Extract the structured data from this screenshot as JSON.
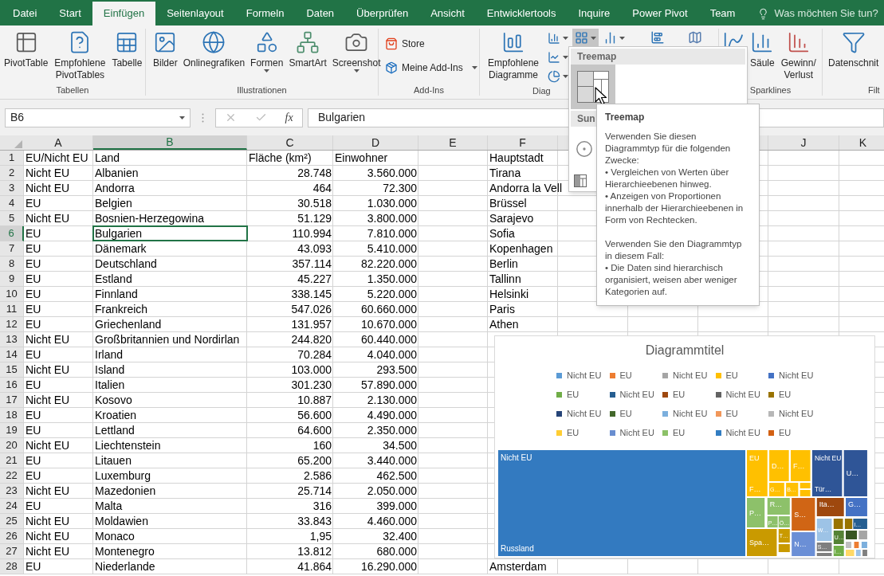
{
  "tabs": [
    {
      "label": "Datei",
      "selected": false
    },
    {
      "label": "Start",
      "selected": false
    },
    {
      "label": "Einfügen",
      "selected": true
    },
    {
      "label": "Seitenlayout",
      "selected": false
    },
    {
      "label": "Formeln",
      "selected": false
    },
    {
      "label": "Daten",
      "selected": false
    },
    {
      "label": "Überprüfen",
      "selected": false
    },
    {
      "label": "Ansicht",
      "selected": false
    },
    {
      "label": "Entwicklertools",
      "selected": false
    },
    {
      "label": "Inquire",
      "selected": false
    },
    {
      "label": "Power Pivot",
      "selected": false
    },
    {
      "label": "Team",
      "selected": false
    }
  ],
  "tell_me": {
    "placeholder": "Was möchten Sie tun?"
  },
  "ribbon": {
    "groups": [
      {
        "label": "Tabellen",
        "buttons": [
          {
            "label": "PivotTable",
            "dropdown": false
          },
          {
            "label": "Empfohlene PivotTables",
            "dropdown": false
          },
          {
            "label": "Tabelle",
            "dropdown": false
          }
        ]
      },
      {
        "label": "Illustrationen",
        "buttons": [
          {
            "label": "Bilder",
            "dropdown": false
          },
          {
            "label": "Onlinegrafiken",
            "dropdown": false
          },
          {
            "label": "Formen",
            "dropdown": true
          },
          {
            "label": "SmartArt",
            "dropdown": false
          },
          {
            "label": "Screenshot",
            "dropdown": true
          }
        ]
      },
      {
        "label": "Add-Ins",
        "buttons": [
          {
            "label": "Store",
            "dropdown": false
          },
          {
            "label": "Meine Add-Ins",
            "dropdown": true
          }
        ]
      },
      {
        "label": "Diag",
        "buttons": [
          {
            "label": "Empfohlene Diagramme",
            "dropdown": false
          }
        ],
        "small_buttons": [
          {
            "pressed": false
          },
          {
            "pressed": false
          },
          {
            "pressed": false
          },
          {
            "pressed": true
          },
          {
            "pressed": false
          }
        ]
      },
      {
        "label": "Sparklines",
        "buttons": [
          {
            "label": "Säule",
            "dropdown": false
          },
          {
            "label": "Gewinn/\nVerlust",
            "dropdown": false
          }
        ]
      },
      {
        "label": "Filt",
        "buttons": [
          {
            "label": "Datenschnit",
            "dropdown": false
          }
        ]
      }
    ]
  },
  "formula_bar": {
    "name_box": "B6",
    "function_button": "fx",
    "value": "Bulgarien"
  },
  "columns": [
    {
      "letter": "A",
      "selected": false
    },
    {
      "letter": "B",
      "selected": true
    },
    {
      "letter": "C",
      "selected": false
    },
    {
      "letter": "D",
      "selected": false
    },
    {
      "letter": "E",
      "selected": false
    },
    {
      "letter": "F",
      "selected": false
    },
    {
      "letter": "J",
      "selected": false
    },
    {
      "letter": "K",
      "selected": false
    }
  ],
  "rows": [
    {
      "number": "1",
      "selected": false,
      "a": "EU/Nicht EU",
      "b": "Land",
      "c": "Fläche (km²)",
      "d": "Einwohner",
      "f": "Hauptstadt"
    },
    {
      "number": "2",
      "selected": false,
      "a": "Nicht EU",
      "b": "Albanien",
      "c": "28.748",
      "d": "3.560.000",
      "f": "Tirana"
    },
    {
      "number": "3",
      "selected": false,
      "a": "Nicht EU",
      "b": "Andorra",
      "c": "464",
      "d": "72.300",
      "f": "Andorra la Vell"
    },
    {
      "number": "4",
      "selected": false,
      "a": "EU",
      "b": "Belgien",
      "c": "30.518",
      "d": "1.030.000",
      "f": "Brüssel"
    },
    {
      "number": "5",
      "selected": false,
      "a": "Nicht EU",
      "b": "Bosnien-Herzegowina",
      "c": "51.129",
      "d": "3.800.000",
      "f": "Sarajevo"
    },
    {
      "number": "6",
      "selected": true,
      "a": "EU",
      "b": "Bulgarien",
      "c": "110.994",
      "d": "7.810.000",
      "f": "Sofia"
    },
    {
      "number": "7",
      "selected": false,
      "a": "EU",
      "b": "Dänemark",
      "c": "43.093",
      "d": "5.410.000",
      "f": "Kopenhagen"
    },
    {
      "number": "8",
      "selected": false,
      "a": "EU",
      "b": "Deutschland",
      "c": "357.114",
      "d": "82.220.000",
      "f": "Berlin"
    },
    {
      "number": "9",
      "selected": false,
      "a": "EU",
      "b": "Estland",
      "c": "45.227",
      "d": "1.350.000",
      "f": "Tallinn"
    },
    {
      "number": "10",
      "selected": false,
      "a": "EU",
      "b": "Finnland",
      "c": "338.145",
      "d": "5.220.000",
      "f": "Helsinki"
    },
    {
      "number": "11",
      "selected": false,
      "a": "EU",
      "b": "Frankreich",
      "c": "547.026",
      "d": "60.660.000",
      "f": "Paris"
    },
    {
      "number": "12",
      "selected": false,
      "a": "EU",
      "b": "Griechenland",
      "c": "131.957",
      "d": "10.670.000",
      "f": "Athen"
    },
    {
      "number": "13",
      "selected": false,
      "a": "Nicht EU",
      "b": "Großbritannien und Nordirlan",
      "c": "244.820",
      "d": "60.440.000"
    },
    {
      "number": "14",
      "selected": false,
      "a": "EU",
      "b": "Irland",
      "c": "70.284",
      "d": "4.040.000"
    },
    {
      "number": "15",
      "selected": false,
      "a": "Nicht EU",
      "b": "Island",
      "c": "103.000",
      "d": "293.500"
    },
    {
      "number": "16",
      "selected": false,
      "a": "EU",
      "b": "Italien",
      "c": "301.230",
      "d": "57.890.000"
    },
    {
      "number": "17",
      "selected": false,
      "a": "Nicht EU",
      "b": "Kosovo",
      "c": "10.887",
      "d": "2.130.000"
    },
    {
      "number": "18",
      "selected": false,
      "a": "EU",
      "b": "Kroatien",
      "c": "56.600",
      "d": "4.490.000"
    },
    {
      "number": "19",
      "selected": false,
      "a": "EU",
      "b": "Lettland",
      "c": "64.600",
      "d": "2.350.000"
    },
    {
      "number": "20",
      "selected": false,
      "a": "Nicht EU",
      "b": "Liechtenstein",
      "c": "160",
      "d": "34.500"
    },
    {
      "number": "21",
      "selected": false,
      "a": "EU",
      "b": "Litauen",
      "c": "65.200",
      "d": "3.440.000"
    },
    {
      "number": "22",
      "selected": false,
      "a": "EU",
      "b": "Luxemburg",
      "c": "2.586",
      "d": "462.500"
    },
    {
      "number": "23",
      "selected": false,
      "a": "Nicht EU",
      "b": "Mazedonien",
      "c": "25.714",
      "d": "2.050.000"
    },
    {
      "number": "24",
      "selected": false,
      "a": "EU",
      "b": "Malta",
      "c": "316",
      "d": "399.000"
    },
    {
      "number": "25",
      "selected": false,
      "a": "Nicht EU",
      "b": "Moldawien",
      "c": "33.843",
      "d": "4.460.000"
    },
    {
      "number": "26",
      "selected": false,
      "a": "Nicht EU",
      "b": "Monaco",
      "c": "1,95",
      "d": "32.400"
    },
    {
      "number": "27",
      "selected": false,
      "a": "Nicht EU",
      "b": "Montenegro",
      "c": "13.812",
      "d": "680.000"
    },
    {
      "number": "28",
      "selected": false,
      "a": "EU",
      "b": "Niederlande",
      "c": "41.864",
      "d": "16.290.000",
      "f": "Amsterdam"
    }
  ],
  "chart_menu": {
    "sections": [
      {
        "title": "Treemap",
        "selected": true
      },
      {
        "title": "Sun",
        "selected": false
      }
    ]
  },
  "tooltip": {
    "title": "Treemap",
    "sections": [
      {
        "lines": [
          "Verwenden Sie diesen Diagrammtyp für die folgenden Zwecke:",
          "• Vergleichen von Werten über Hierarchieebenen hinweg.",
          "• Anzeigen von Proportionen innerhalb der Hierarchieebenen in Form von Rechtecken."
        ]
      },
      {
        "lines": [
          "Verwenden Sie den Diagrammtyp in diesem Fall:",
          "• Die Daten sind hierarchisch organisiert, weisen aber weniger Kategorien auf."
        ]
      }
    ]
  },
  "chart": {
    "title": "Diagrammtitel",
    "legend": [
      {
        "label": "Nicht EU",
        "color": "#5b9bd5"
      },
      {
        "label": "EU",
        "color": "#ed7d31"
      },
      {
        "label": "Nicht EU",
        "color": "#a5a5a5"
      },
      {
        "label": "EU",
        "color": "#ffc000"
      },
      {
        "label": "Nicht EU",
        "color": "#4472c4"
      },
      {
        "label": "EU",
        "color": "#70ad47"
      },
      {
        "label": "Nicht EU",
        "color": "#255e91"
      },
      {
        "label": "EU",
        "color": "#9e480e"
      },
      {
        "label": "Nicht EU",
        "color": "#636363"
      },
      {
        "label": "EU",
        "color": "#997300"
      },
      {
        "label": "Nicht EU",
        "color": "#264478"
      },
      {
        "label": "EU",
        "color": "#43682b"
      },
      {
        "label": "Nicht EU",
        "color": "#7cafdd"
      },
      {
        "label": "EU",
        "color": "#f1975a"
      },
      {
        "label": "Nicht EU",
        "color": "#b7b7b7"
      },
      {
        "label": "EU",
        "color": "#ffcd33"
      },
      {
        "label": "Nicht EU",
        "color": "#698ed0"
      },
      {
        "label": "EU",
        "color": "#8cc168"
      },
      {
        "label": "Nicht EU",
        "color": "#327dc2"
      },
      {
        "label": "EU",
        "color": "#d26012"
      }
    ],
    "tiles": [
      {
        "color": "#337ac0",
        "labels": [
          "Nicht EU",
          "Russland"
        ]
      },
      {
        "color": "#ffc000",
        "labels": [
          "EU",
          "F…"
        ]
      },
      {
        "color": "#ffc000",
        "labels": [
          "D…"
        ]
      },
      {
        "color": "#ffc000",
        "labels": [
          "F…"
        ]
      },
      {
        "color": "#ffc000",
        "labels": [
          "G…"
        ]
      },
      {
        "color": "#ffc000",
        "labels": [
          "B…"
        ]
      },
      {
        "color": "#ffc000"
      },
      {
        "color": "#ffc000"
      },
      {
        "color": "#2f5597",
        "labels": [
          "Nicht EU",
          "Tür…"
        ]
      },
      {
        "color": "#2f5597",
        "labels": [
          "U…"
        ]
      },
      {
        "color": "#8dc16a",
        "labels": [
          "P…"
        ]
      },
      {
        "color": "#8dc16a",
        "labels": [
          "R…"
        ]
      },
      {
        "color": "#8dc16a",
        "labels": [
          "P…"
        ]
      },
      {
        "color": "#8dc16a",
        "labels": [
          "Ö…"
        ]
      },
      {
        "color": "#d06515",
        "labels": [
          "S…"
        ]
      },
      {
        "color": "#9e480e",
        "labels": [
          "Ita…"
        ]
      },
      {
        "color": "#4472c4",
        "labels": [
          "G…"
        ]
      },
      {
        "color": "#c99a00",
        "labels": [
          "Spa…"
        ]
      },
      {
        "color": "#c99a00",
        "labels": [
          "T…"
        ]
      },
      {
        "color": "#c99a00"
      },
      {
        "color": "#6b8fd6",
        "labels": [
          "N…"
        ]
      },
      {
        "color": "#9dc3e6",
        "labels": [
          "W…"
        ]
      },
      {
        "color": "#7f7f7f",
        "labels": [
          "S…"
        ]
      },
      {
        "color": "#7f7f7f"
      },
      {
        "color": "#997300"
      },
      {
        "color": "#997300"
      },
      {
        "color": "#255e91",
        "labels": [
          "I…"
        ]
      },
      {
        "color": "#548235",
        "labels": [
          "U…"
        ]
      },
      {
        "color": "#375623"
      },
      {
        "color": "#a5a5a5"
      },
      {
        "color": "#70ad47",
        "labels": [
          "I…"
        ]
      },
      {
        "color": "#bfbfbf"
      },
      {
        "color": "#ed7d31"
      },
      {
        "color": "#7cafdd"
      },
      {
        "color": "#ffd966"
      },
      {
        "color": "#9dc3e6"
      },
      {
        "color": "#7f7f7f"
      }
    ]
  }
}
